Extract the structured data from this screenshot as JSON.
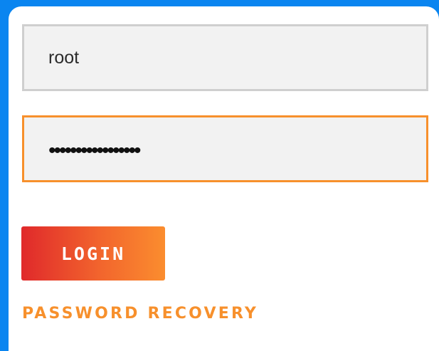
{
  "login_form": {
    "username_value": "root",
    "password_value": "•••••••••••••••••",
    "login_label": "LOGIN",
    "recovery_label": "PASSWORD RECOVERY"
  },
  "colors": {
    "background": "#0a85f0",
    "accent": "#f7902c",
    "button_gradient_start": "#e0292b",
    "button_gradient_end": "#fb8d2e",
    "field_fill": "#f2f2f2",
    "field_border": "#cfcfcf"
  }
}
